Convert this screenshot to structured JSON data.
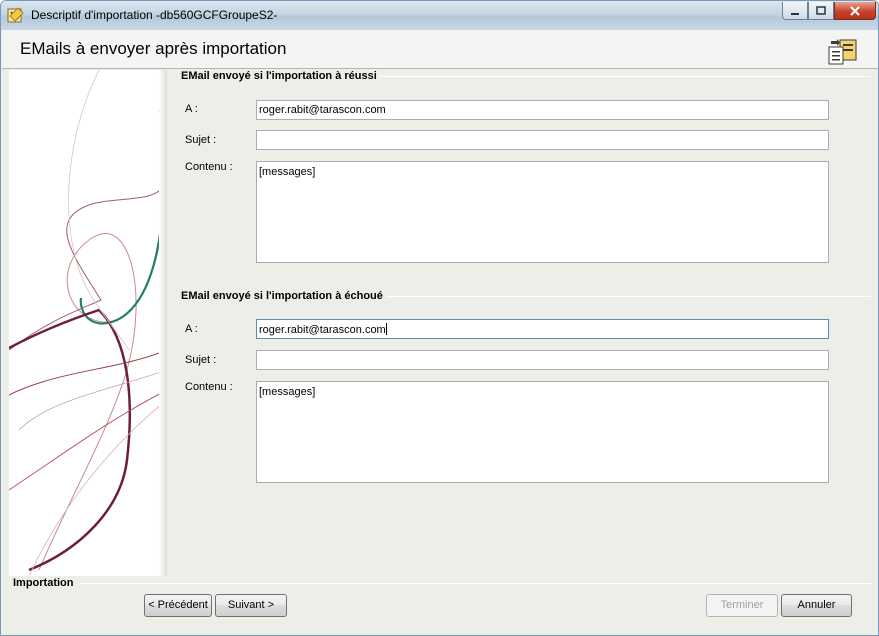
{
  "window": {
    "title": "Descriptif d'importation -db560GCFGroupeS2-",
    "app_icon": "import-wizard-icon"
  },
  "header": {
    "title": "EMails à envoyer après importation",
    "icon": "documents-export-icon"
  },
  "success_section": {
    "title": "EMail envoyé si l'importation à réussi",
    "to_label": "A :",
    "to_value": "roger.rabit@tarascon.com",
    "subject_label": "Sujet :",
    "subject_value": "",
    "content_label": "Contenu :",
    "content_value": "[messages]"
  },
  "failure_section": {
    "title": "EMail envoyé si l'importation à échoué",
    "to_label": "A :",
    "to_value": "roger.rabit@tarascon.com",
    "subject_label": "Sujet :",
    "subject_value": "",
    "content_label": "Contenu :",
    "content_value": "[messages]"
  },
  "footer": {
    "group_label": "Importation",
    "prev_label": "< Précédent",
    "next_label": "Suivant >",
    "finish_label": "Terminer",
    "cancel_label": "Annuler"
  }
}
